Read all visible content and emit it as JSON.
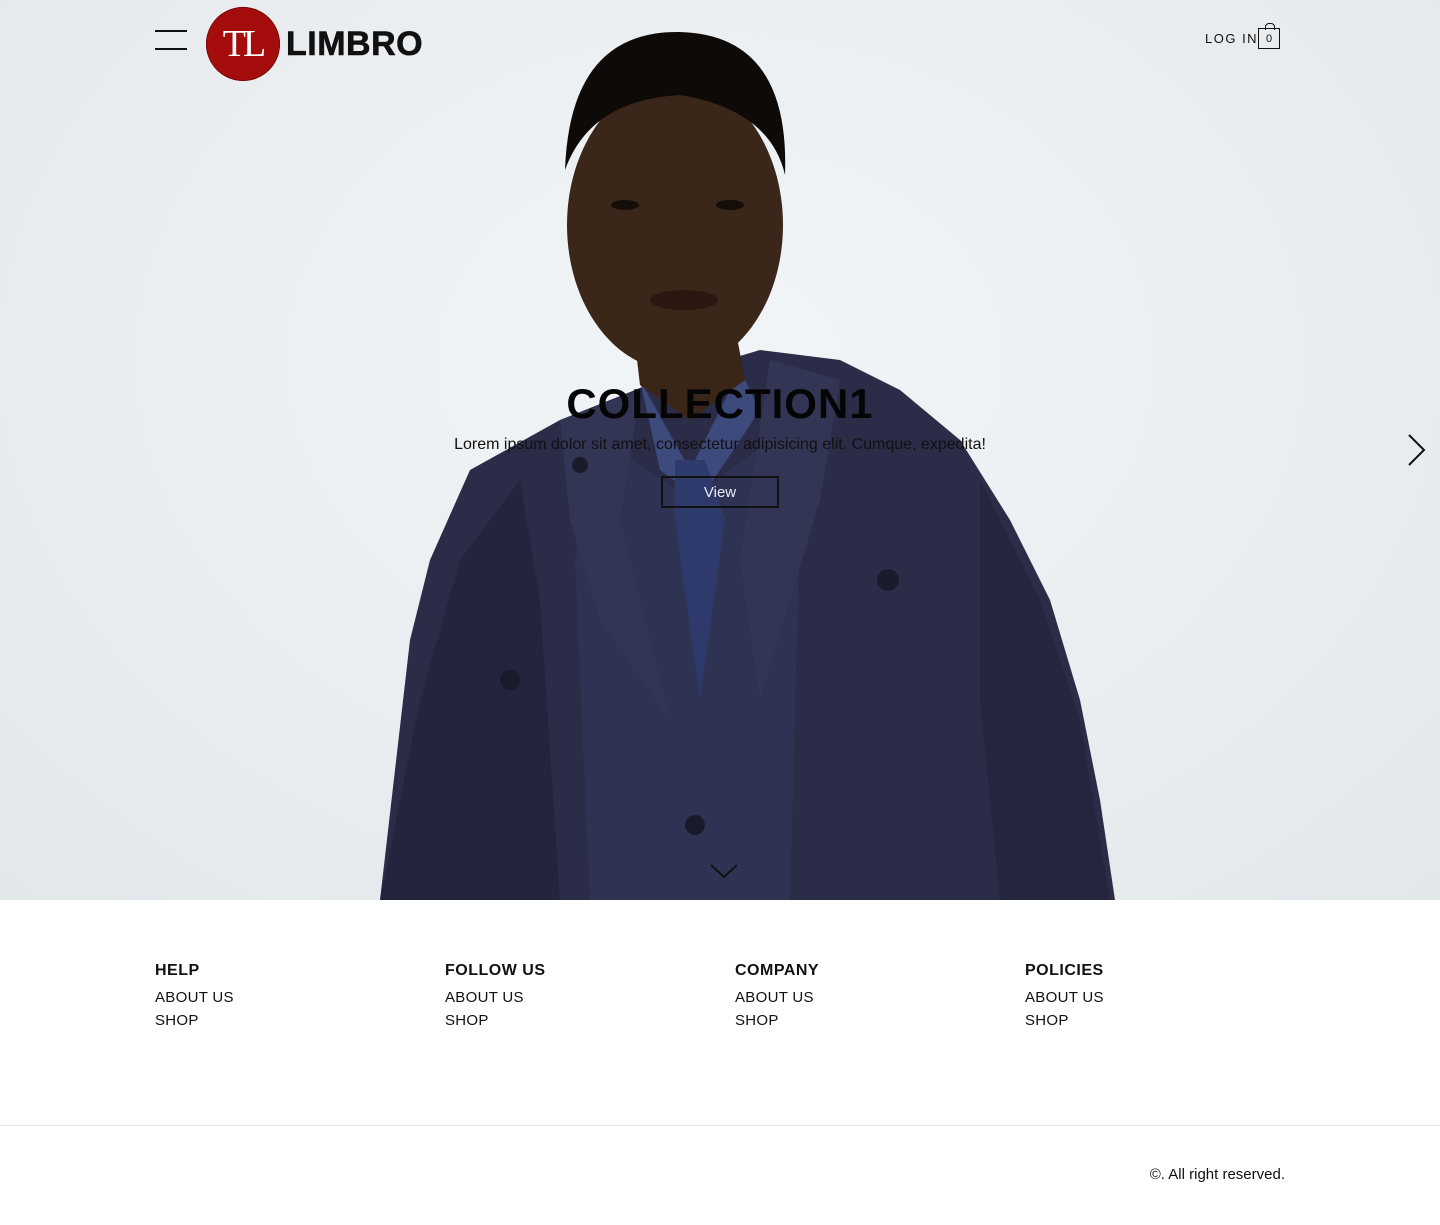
{
  "header": {
    "brand_mark": "TL",
    "brand_name": "LIMBRO",
    "login_label": "LOG IN",
    "cart_count": "0"
  },
  "hero": {
    "title": "COLLECTION1",
    "subtitle": "Lorem ipsum dolor sit amet, consectetur adipisicing elit. Cumque, expedita!",
    "button_label": "View"
  },
  "footer": {
    "columns": [
      {
        "heading": "HELP",
        "links": [
          "ABOUT US",
          "SHOP"
        ]
      },
      {
        "heading": "FOLLOW US",
        "links": [
          "ABOUT US",
          "SHOP"
        ]
      },
      {
        "heading": "COMPANY",
        "links": [
          "ABOUT US",
          "SHOP"
        ]
      },
      {
        "heading": "POLICIES",
        "links": [
          "ABOUT US",
          "SHOP"
        ]
      }
    ],
    "copyright": "©. All right reserved."
  },
  "colors": {
    "brand_red": "#a50d0d",
    "text": "#111111",
    "hero_bg": "#e9edf0",
    "coat": "#2a2b45"
  },
  "icons": [
    "menu-icon",
    "cart-icon",
    "chevron-right-icon",
    "chevron-down-icon"
  ]
}
